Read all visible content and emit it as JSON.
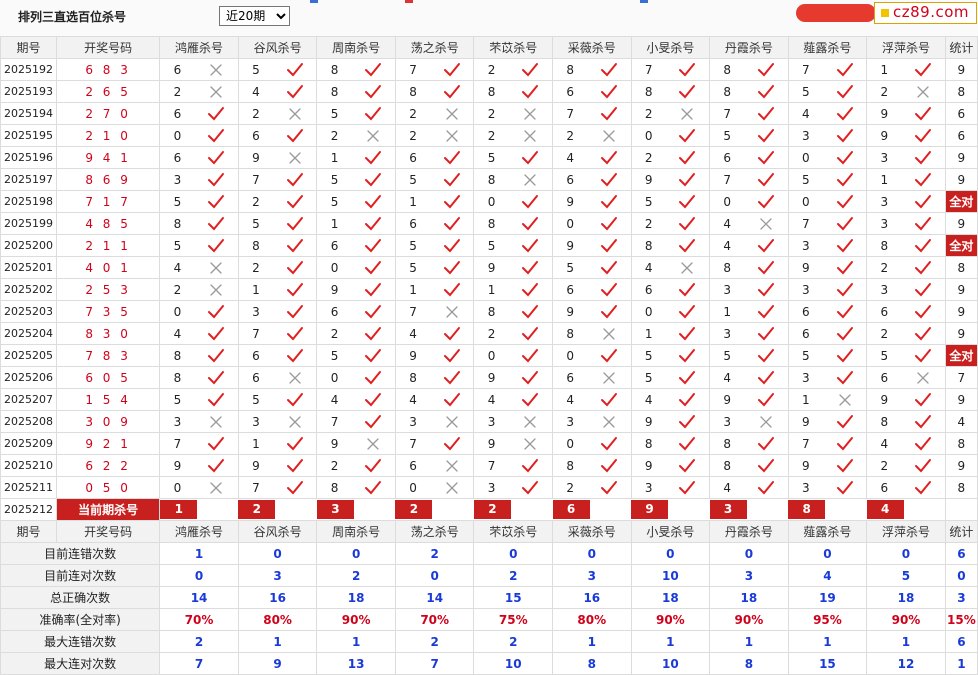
{
  "page": {
    "title": "排列三直选百位杀号",
    "period_select": "近20期",
    "period_options": [
      "近20期"
    ],
    "site_badge": "cz89.com"
  },
  "columns": {
    "issue": "期号",
    "draw": "开奖号码",
    "experts": [
      "鸿雁杀号",
      "谷风杀号",
      "周南杀号",
      "荡之杀号",
      "芣苡杀号",
      "采薇杀号",
      "小旻杀号",
      "丹霞杀号",
      "薤露杀号",
      "浮萍杀号"
    ],
    "total": "统计"
  },
  "rows": [
    {
      "issue": "2025192",
      "draw": "6 8 3",
      "kills": [
        6,
        5,
        8,
        7,
        2,
        8,
        7,
        8,
        7,
        1
      ],
      "marks": "xvvvvvvvvv",
      "total": "9"
    },
    {
      "issue": "2025193",
      "draw": "2 6 5",
      "kills": [
        2,
        4,
        8,
        8,
        8,
        6,
        8,
        8,
        5,
        2
      ],
      "marks": "xvvvvvvvvx",
      "total": "8"
    },
    {
      "issue": "2025194",
      "draw": "2 7 0",
      "kills": [
        6,
        2,
        5,
        2,
        2,
        7,
        2,
        7,
        4,
        9
      ],
      "marks": "vxvxxvxvvv",
      "total": "6"
    },
    {
      "issue": "2025195",
      "draw": "2 1 0",
      "kills": [
        0,
        6,
        2,
        2,
        2,
        2,
        0,
        5,
        3,
        9
      ],
      "marks": "vvxxxxvvvv",
      "total": "6"
    },
    {
      "issue": "2025196",
      "draw": "9 4 1",
      "kills": [
        6,
        9,
        1,
        6,
        5,
        4,
        2,
        6,
        0,
        3
      ],
      "marks": "vxvvvvvvvv",
      "total": "9"
    },
    {
      "issue": "2025197",
      "draw": "8 6 9",
      "kills": [
        3,
        7,
        5,
        5,
        8,
        6,
        9,
        7,
        5,
        1
      ],
      "marks": "vvvvxvvvvv",
      "total": "9"
    },
    {
      "issue": "2025198",
      "draw": "7 1 7",
      "kills": [
        5,
        2,
        5,
        1,
        0,
        9,
        5,
        0,
        0,
        3
      ],
      "marks": "vvvvvvvvvv",
      "total": "全对"
    },
    {
      "issue": "2025199",
      "draw": "4 8 5",
      "kills": [
        8,
        5,
        1,
        6,
        8,
        0,
        2,
        4,
        7,
        3
      ],
      "marks": "vvvvvvvxvv",
      "total": "9"
    },
    {
      "issue": "2025200",
      "draw": "2 1 1",
      "kills": [
        5,
        8,
        6,
        5,
        5,
        9,
        8,
        4,
        3,
        8
      ],
      "marks": "vvvvvvvvvv",
      "total": "全对"
    },
    {
      "issue": "2025201",
      "draw": "4 0 1",
      "kills": [
        4,
        2,
        0,
        5,
        9,
        5,
        4,
        8,
        9,
        2
      ],
      "marks": "xvvvvvxvvv",
      "total": "8"
    },
    {
      "issue": "2025202",
      "draw": "2 5 3",
      "kills": [
        2,
        1,
        9,
        1,
        1,
        6,
        6,
        3,
        3,
        3
      ],
      "marks": "xvvvvvvvvv",
      "total": "9"
    },
    {
      "issue": "2025203",
      "draw": "7 3 5",
      "kills": [
        0,
        3,
        6,
        7,
        8,
        9,
        0,
        1,
        6,
        6
      ],
      "marks": "vvvxvvvvvv",
      "total": "9"
    },
    {
      "issue": "2025204",
      "draw": "8 3 0",
      "kills": [
        4,
        7,
        2,
        4,
        2,
        8,
        1,
        3,
        6,
        2
      ],
      "marks": "vvvvvxvvvv",
      "total": "9"
    },
    {
      "issue": "2025205",
      "draw": "7 8 3",
      "kills": [
        8,
        6,
        5,
        9,
        0,
        0,
        5,
        5,
        5,
        5
      ],
      "marks": "vvvvvvvvvv",
      "total": "全对"
    },
    {
      "issue": "2025206",
      "draw": "6 0 5",
      "kills": [
        8,
        6,
        0,
        8,
        9,
        6,
        5,
        4,
        3,
        6
      ],
      "marks": "vxvvvxvvvx",
      "total": "7"
    },
    {
      "issue": "2025207",
      "draw": "1 5 4",
      "kills": [
        5,
        5,
        4,
        4,
        4,
        4,
        4,
        9,
        1,
        9
      ],
      "marks": "vvvvvvvvxv",
      "total": "9"
    },
    {
      "issue": "2025208",
      "draw": "3 0 9",
      "kills": [
        3,
        3,
        7,
        3,
        3,
        3,
        9,
        3,
        9,
        8
      ],
      "marks": "xxvxxxvxvv",
      "total": "4"
    },
    {
      "issue": "2025209",
      "draw": "9 2 1",
      "kills": [
        7,
        1,
        9,
        7,
        9,
        0,
        8,
        8,
        7,
        4
      ],
      "marks": "vvxvxvvvvv",
      "total": "8"
    },
    {
      "issue": "2025210",
      "draw": "6 2 2",
      "kills": [
        9,
        9,
        2,
        6,
        7,
        8,
        9,
        8,
        9,
        2
      ],
      "marks": "vvvxvvvvvv",
      "total": "9"
    },
    {
      "issue": "2025211",
      "draw": "0 5 0",
      "kills": [
        0,
        7,
        8,
        0,
        3,
        2,
        3,
        4,
        3,
        6
      ],
      "marks": "xvvxvvvvvv",
      "total": "8"
    }
  ],
  "current": {
    "issue": "2025212",
    "label": "当前期杀号",
    "kills": [
      1,
      2,
      3,
      2,
      2,
      6,
      9,
      3,
      8,
      4
    ]
  },
  "stats": [
    {
      "label": "目前连错次数",
      "values": [
        "1",
        "0",
        "0",
        "2",
        "0",
        "0",
        "0",
        "0",
        "0",
        "0"
      ],
      "total": "6"
    },
    {
      "label": "目前连对次数",
      "values": [
        "0",
        "3",
        "2",
        "0",
        "2",
        "3",
        "10",
        "3",
        "4",
        "5"
      ],
      "total": "0"
    },
    {
      "label": "总正确次数",
      "values": [
        "14",
        "16",
        "18",
        "14",
        "15",
        "16",
        "18",
        "18",
        "19",
        "18"
      ],
      "total": "3"
    },
    {
      "label": "准确率(全对率)",
      "values": [
        "70%",
        "80%",
        "90%",
        "70%",
        "75%",
        "80%",
        "90%",
        "90%",
        "95%",
        "90%"
      ],
      "total": "15%"
    },
    {
      "label": "最大连错次数",
      "values": [
        "2",
        "1",
        "1",
        "2",
        "2",
        "1",
        "1",
        "1",
        "1",
        "1"
      ],
      "total": "6"
    },
    {
      "label": "最大连对次数",
      "values": [
        "7",
        "9",
        "13",
        "7",
        "10",
        "8",
        "10",
        "8",
        "15",
        "12"
      ],
      "total": "1"
    }
  ],
  "colors": {
    "accent_red": "#c8201e",
    "draw_red": "#d0021b",
    "stat_blue": "#1a3ad8",
    "check_red": "#e02020",
    "cross_grey": "#9a9a9a"
  }
}
